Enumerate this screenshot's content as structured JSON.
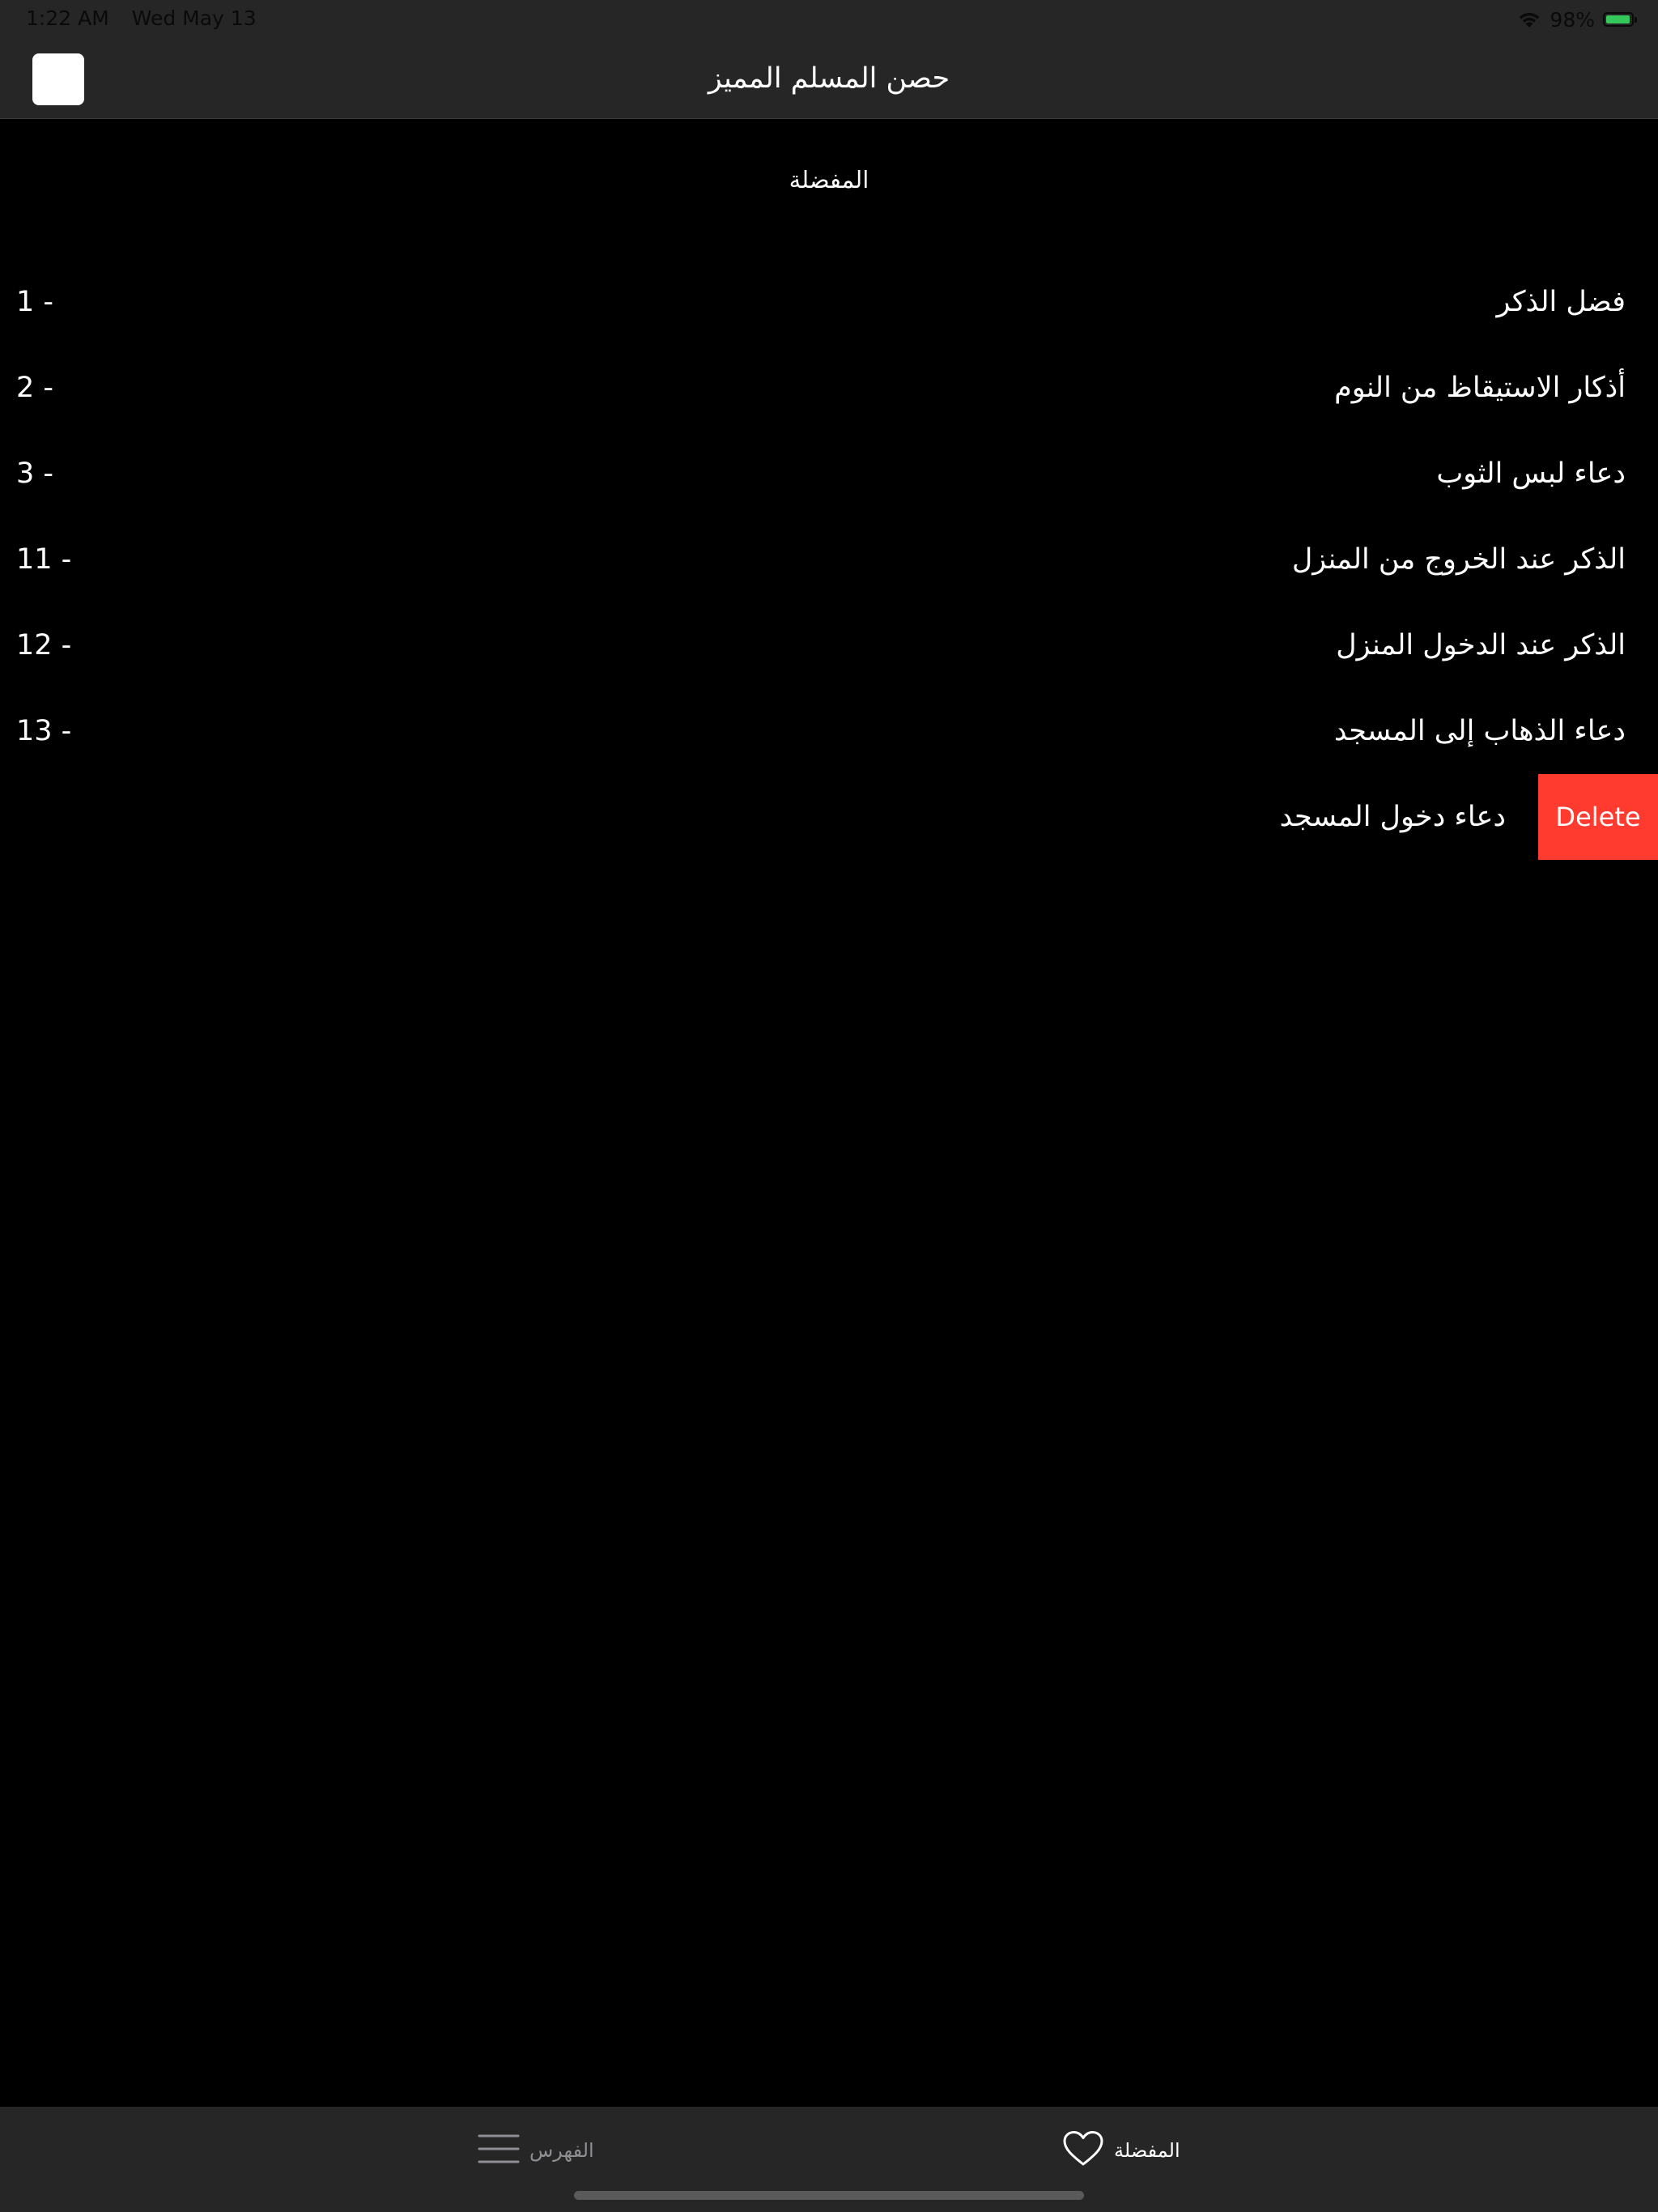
{
  "status_bar": {
    "time": "1:22 AM",
    "date": "Wed May 13",
    "battery_percent": "98%",
    "battery_level": 0.98,
    "battery_color": "#34c759"
  },
  "nav": {
    "title": "حصن المسلم المميز"
  },
  "section": {
    "header": "المفضلة"
  },
  "favorites": [
    {
      "number": "1 -",
      "title": "فضل الذكر"
    },
    {
      "number": "2 -",
      "title": "أذكار الاستيقاظ من النوم"
    },
    {
      "number": "3 -",
      "title": "دعاء لبس الثوب"
    },
    {
      "number": "11 -",
      "title": "الذكر عند الخروج من المنزل"
    },
    {
      "number": "12 -",
      "title": "الذكر عند الدخول المنزل"
    },
    {
      "number": "13 -",
      "title": "دعاء الذهاب إلى المسجد"
    },
    {
      "number": "",
      "title": "دعاء دخول المسجد",
      "swiped": true,
      "action_label": "Delete"
    }
  ],
  "colors": {
    "background": "#000000",
    "bar": "#262626",
    "delete": "#ff3b30"
  },
  "tabs": [
    {
      "label": "الفهرس",
      "icon": "list-icon",
      "selected": false
    },
    {
      "label": "المفضلة",
      "icon": "heart-icon",
      "selected": true
    }
  ]
}
